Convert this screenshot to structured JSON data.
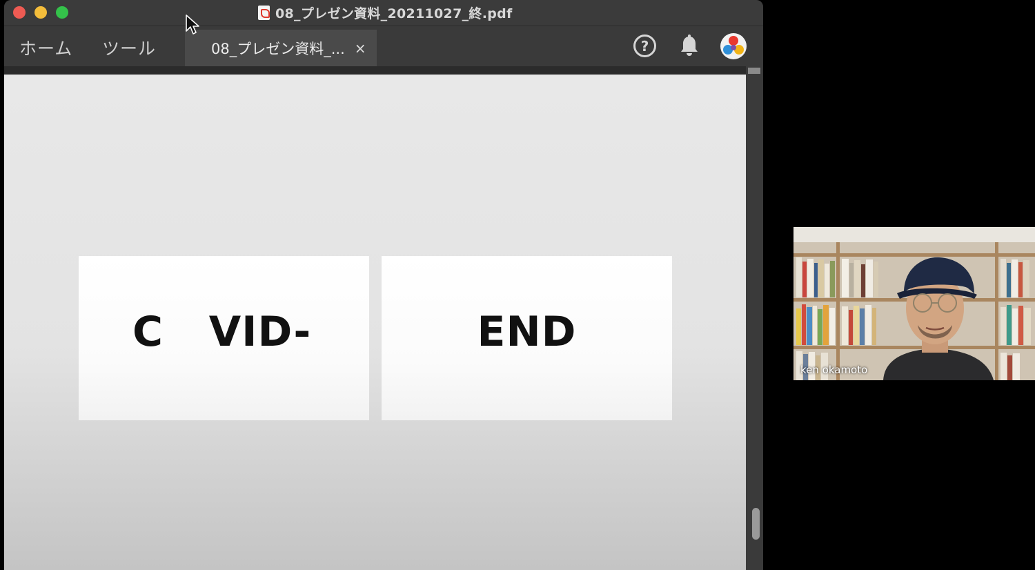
{
  "window": {
    "title": "08_プレゼン資料_20211027_終.pdf"
  },
  "nav": {
    "home_label": "ホーム",
    "tools_label": "ツール"
  },
  "doc_tab": {
    "label": "08_プレゼン資料_...",
    "close_label": "×"
  },
  "header_icons": {
    "help": "?",
    "notifications": "bell-icon",
    "account": "avatar-icon"
  },
  "slides": [
    {
      "text": "C   VID-"
    },
    {
      "text": "END"
    }
  ],
  "video": {
    "participant_name": "ken okamoto"
  },
  "colors": {
    "close": "#ee5b53",
    "minimize": "#f4bd3b",
    "zoom": "#34c24a"
  }
}
